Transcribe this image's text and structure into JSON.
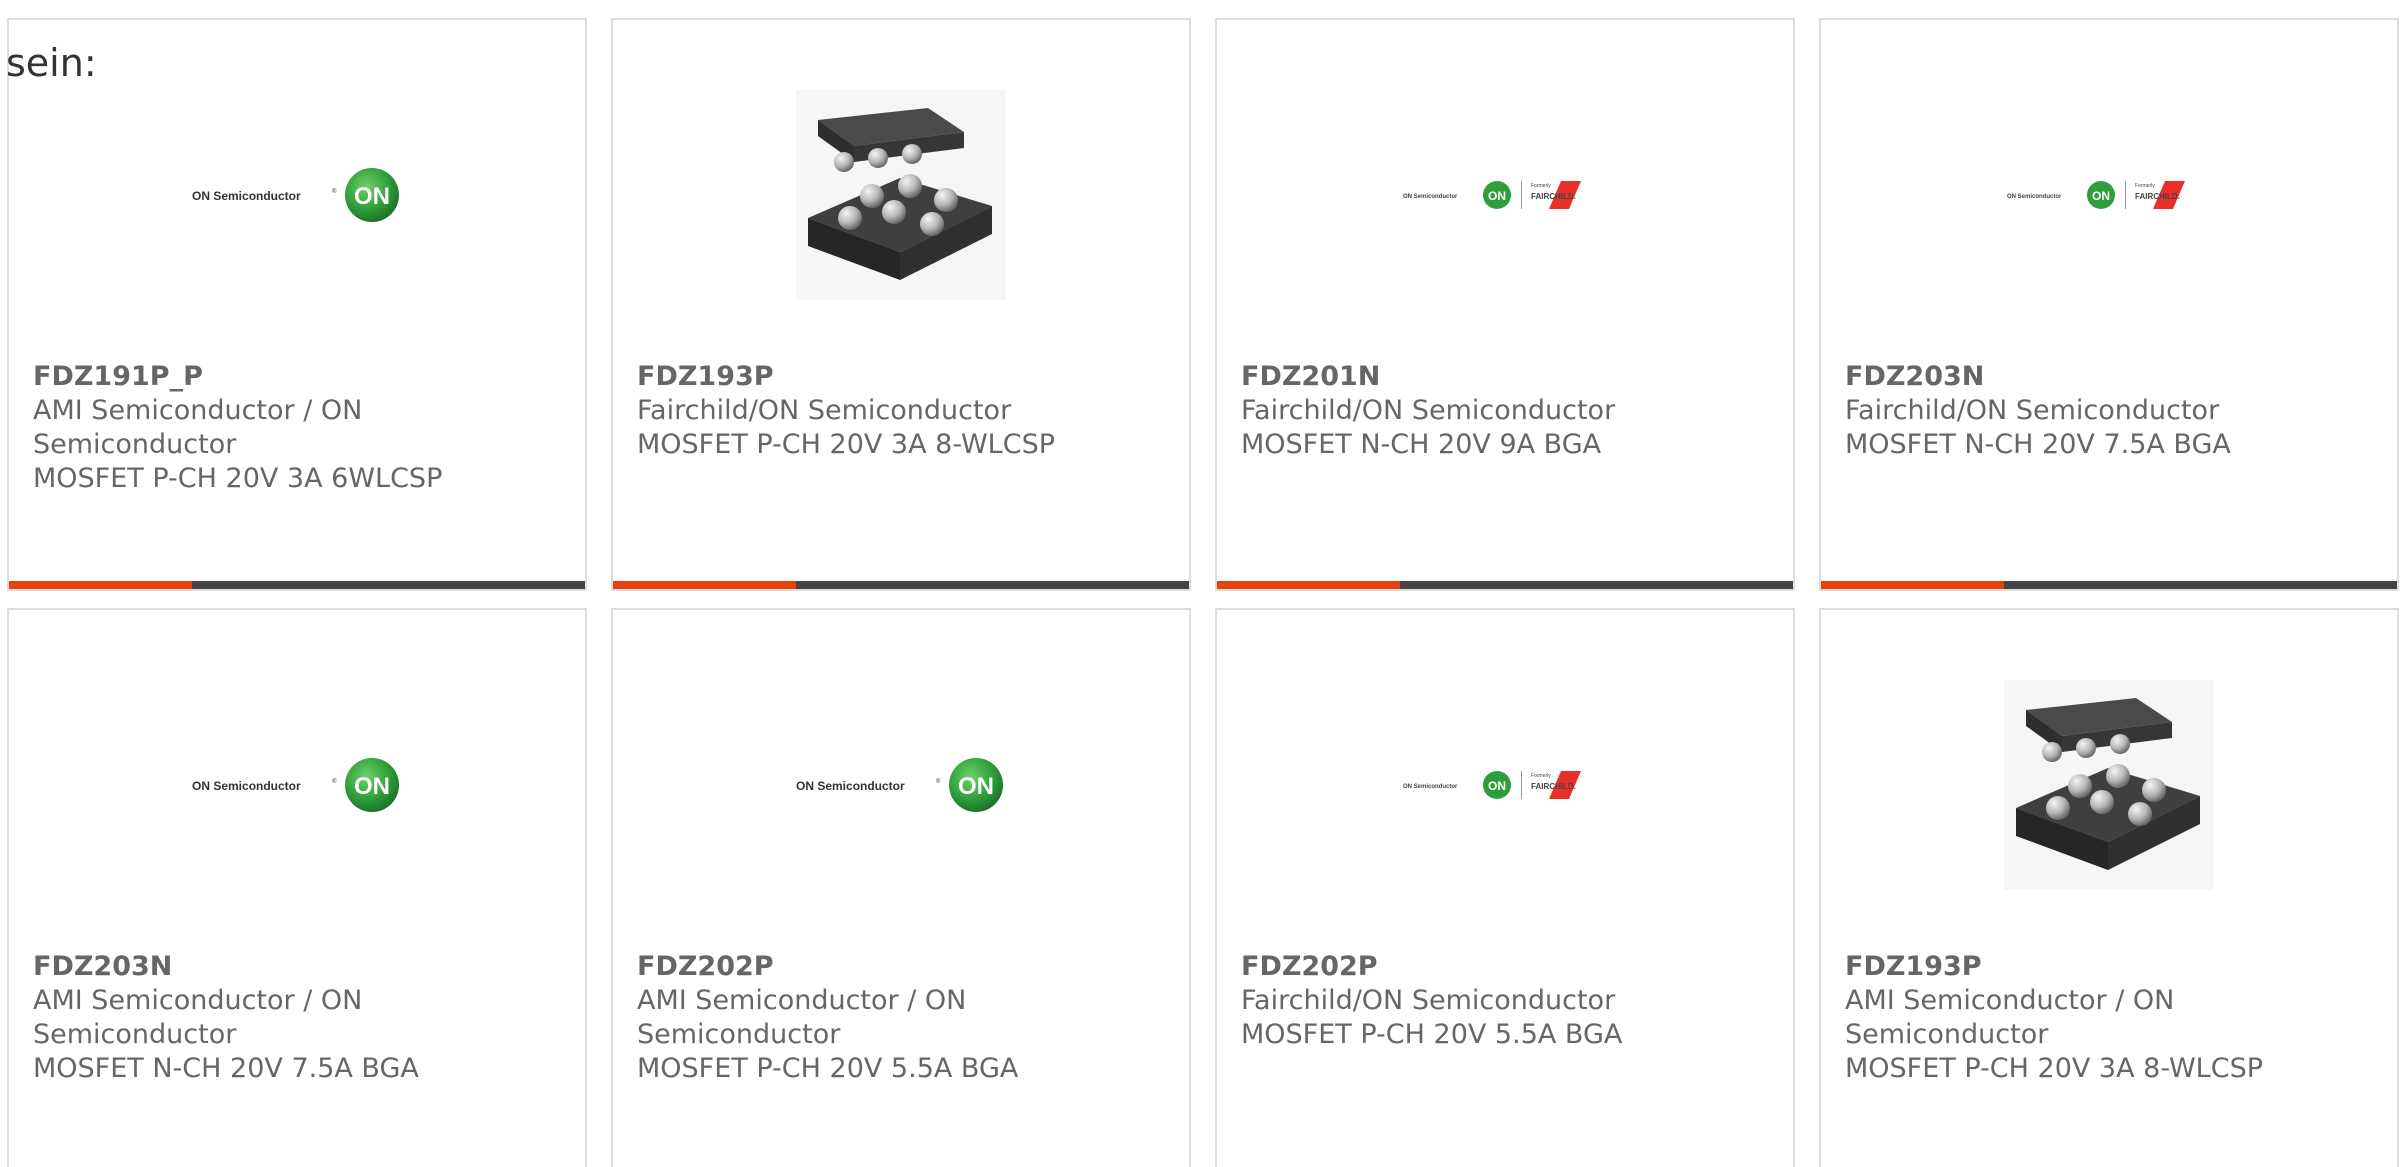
{
  "intro": {
    "text": "sein:"
  },
  "colors": {
    "accent": "#e8400c",
    "bar_dark": "#444444",
    "on_green": "#2e9e3a",
    "fairchild_red": "#e8302a"
  },
  "logos": {
    "on_semi": {
      "brand": "ON Semiconductor",
      "mark": "ON",
      "reg": "®"
    },
    "fairchild": {
      "formerly": "Formerly",
      "name": "FAIRCHILD."
    }
  },
  "products": [
    {
      "part": "FDZ191P_P",
      "maker": "AMI Semiconductor / ON Semiconductor",
      "desc": "MOSFET P-CH 20V 3A 6WLCSP",
      "image": "on-semi-logo"
    },
    {
      "part": "FDZ193P",
      "maker": "Fairchild/ON Semiconductor",
      "desc": "MOSFET P-CH 20V 3A 8-WLCSP",
      "image": "wlcsp-chip-photo"
    },
    {
      "part": "FDZ201N",
      "maker": "Fairchild/ON Semiconductor",
      "desc": "MOSFET N-CH 20V 9A BGA",
      "image": "on-fairchild-logo"
    },
    {
      "part": "FDZ203N",
      "maker": "Fairchild/ON Semiconductor",
      "desc": "MOSFET N-CH 20V 7.5A BGA",
      "image": "on-fairchild-logo"
    },
    {
      "part": "FDZ203N",
      "maker": "AMI Semiconductor / ON Semiconductor",
      "desc": "MOSFET N-CH 20V 7.5A BGA",
      "image": "on-semi-logo"
    },
    {
      "part": "FDZ202P",
      "maker": "AMI Semiconductor / ON Semiconductor",
      "desc": "MOSFET P-CH 20V 5.5A BGA",
      "image": "on-semi-logo"
    },
    {
      "part": "FDZ202P",
      "maker": "Fairchild/ON Semiconductor",
      "desc": "MOSFET P-CH 20V 5.5A BGA",
      "image": "on-fairchild-logo"
    },
    {
      "part": "FDZ193P",
      "maker": "AMI Semiconductor / ON Semiconductor",
      "desc": "MOSFET P-CH 20V 3A 8-WLCSP",
      "image": "wlcsp-chip-photo"
    }
  ]
}
